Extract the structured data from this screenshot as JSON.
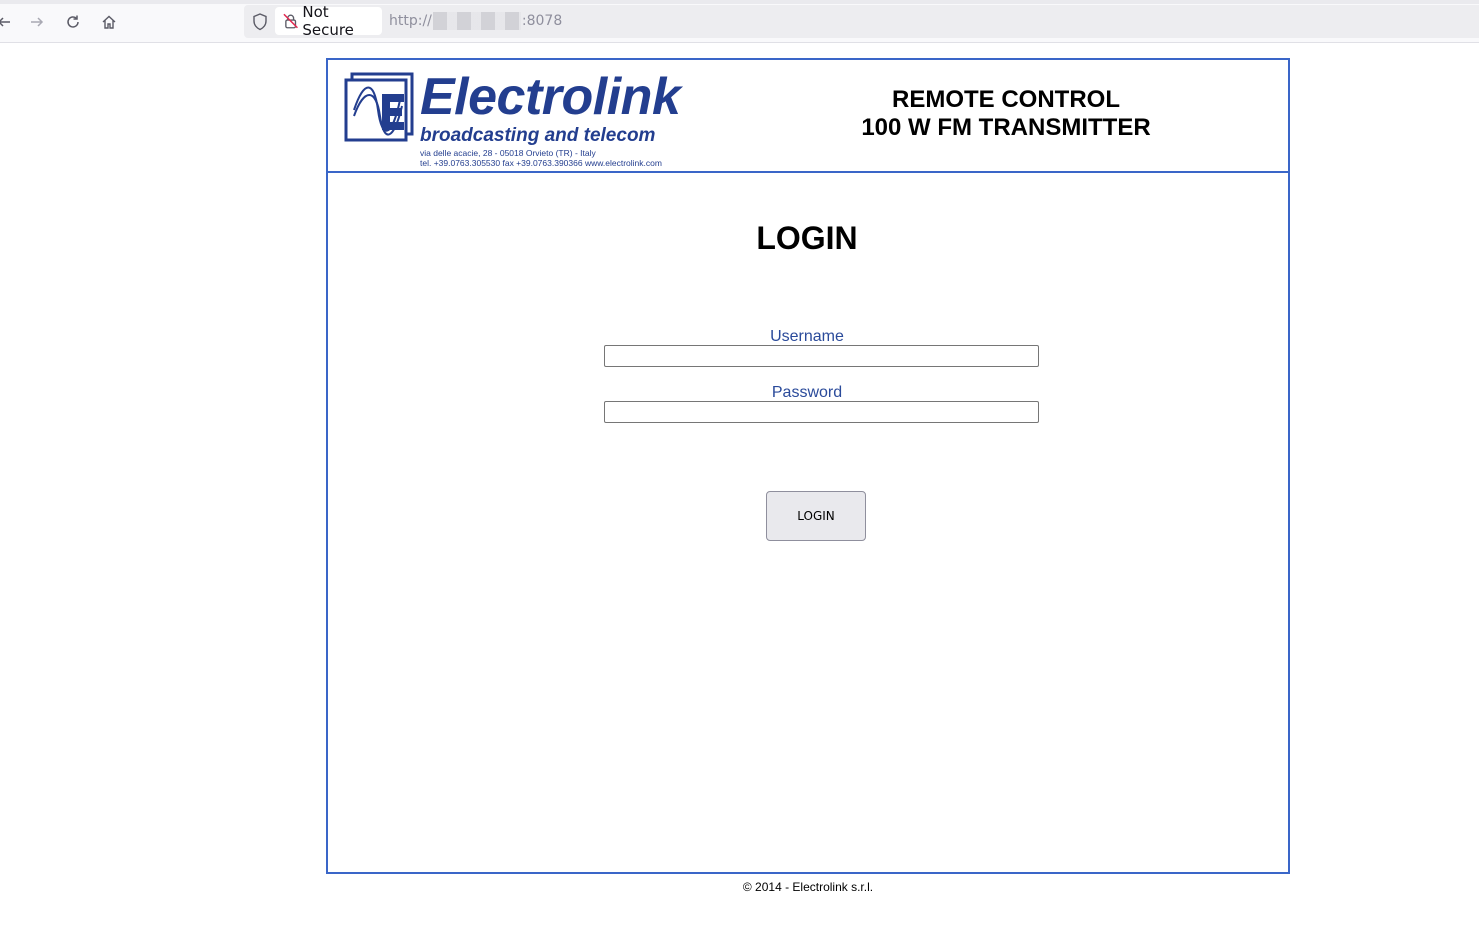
{
  "browser": {
    "security_label": "Not Secure",
    "url_prefix": "http://",
    "url_suffix": ":8078"
  },
  "header": {
    "logo": {
      "brand": "Electrolink",
      "tagline": "broadcasting and telecom",
      "address_line1": "via delle acacie, 28 - 05018 Orvieto (TR) - Italy",
      "address_line2": "tel. +39.0763.305530 fax +39.0763.390366 www.electrolink.com",
      "color": "#233e8f"
    },
    "title_line1": "REMOTE CONTROL",
    "title_line2": "100 W FM TRANSMITTER"
  },
  "login": {
    "heading": "LOGIN",
    "username_label": "Username",
    "username_value": "",
    "password_label": "Password",
    "password_value": "",
    "button_label": "LOGIN"
  },
  "footer": {
    "copyright": "© 2014 - Electrolink s.r.l."
  },
  "colors": {
    "frame_border": "#3a66c8",
    "label_text": "#2a4a9a"
  }
}
